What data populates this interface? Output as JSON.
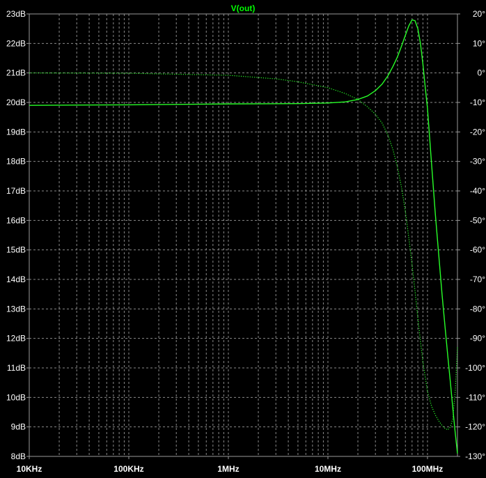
{
  "chart_data": {
    "type": "line",
    "title": "V(out)",
    "background": "#000000",
    "colors": {
      "trace": "#28ff28",
      "title": "#00ff00",
      "axis_text": "#ffffff",
      "grid": "#8a8a8a",
      "frame": "#9a9a9a"
    },
    "x_scale": "log",
    "x_range_hz": [
      10000,
      200000000
    ],
    "x_tick_values": [
      10000,
      100000,
      1000000,
      10000000,
      100000000
    ],
    "x_tick_labels": [
      "10KHz",
      "100KHz",
      "1MHz",
      "10MHz",
      "100MHz"
    ],
    "y_left_range": [
      8,
      23
    ],
    "y_left_ticks": [
      8,
      9,
      10,
      11,
      12,
      13,
      14,
      15,
      16,
      17,
      18,
      19,
      20,
      21,
      22,
      23
    ],
    "y_left_tick_labels": [
      "8dB",
      "9dB",
      "10dB",
      "11dB",
      "12dB",
      "13dB",
      "14dB",
      "15dB",
      "16dB",
      "17dB",
      "18dB",
      "19dB",
      "20dB",
      "21dB",
      "22dB",
      "23dB"
    ],
    "y_right_range": [
      -130,
      20
    ],
    "y_right_ticks": [
      -130,
      -120,
      -110,
      -100,
      -90,
      -80,
      -70,
      -60,
      -50,
      -40,
      -30,
      -20,
      -10,
      0,
      10,
      20
    ],
    "y_right_tick_labels": [
      "-130°",
      "-120°",
      "-110°",
      "-100°",
      "-90°",
      "-80°",
      "-70°",
      "-60°",
      "-50°",
      "-40°",
      "-30°",
      "-20°",
      "-10°",
      "0°",
      "10°",
      "20°"
    ],
    "grid": true,
    "series": [
      {
        "name": "magnitude",
        "axis": "left",
        "style": "solid",
        "x": [
          10000,
          100000,
          1000000,
          5000000,
          10000000,
          15000000,
          20000000,
          25000000,
          30000000,
          35000000,
          40000000,
          45000000,
          50000000,
          55000000,
          60000000,
          65000000,
          70000000,
          75000000,
          80000000,
          85000000,
          90000000,
          95000000,
          100000000,
          110000000,
          120000000,
          130000000,
          140000000,
          150000000,
          160000000,
          170000000,
          180000000,
          190000000,
          200000000
        ],
        "y": [
          19.9,
          19.92,
          19.95,
          19.96,
          19.98,
          20.02,
          20.1,
          20.22,
          20.4,
          20.62,
          20.9,
          21.22,
          21.55,
          21.92,
          22.28,
          22.6,
          22.8,
          22.77,
          22.5,
          22.0,
          21.3,
          20.5,
          19.8,
          17.9,
          16.2,
          14.8,
          13.5,
          12.4,
          11.4,
          10.5,
          9.6,
          8.8,
          8.1
        ]
      },
      {
        "name": "phase",
        "axis": "right",
        "style": "dotted",
        "x": [
          10000,
          100000,
          1000000,
          3000000,
          5000000,
          10000000,
          15000000,
          20000000,
          25000000,
          30000000,
          35000000,
          40000000,
          45000000,
          50000000,
          55000000,
          60000000,
          65000000,
          70000000,
          75000000,
          80000000,
          85000000,
          90000000,
          100000000,
          110000000,
          120000000,
          130000000,
          140000000,
          150000000,
          160000000,
          170000000,
          180000000,
          190000000,
          200000000
        ],
        "y": [
          0,
          -0.1,
          -0.8,
          -2.0,
          -3.0,
          -5.0,
          -7.0,
          -9.0,
          -11.5,
          -14.0,
          -17.0,
          -21.0,
          -26.0,
          -32.0,
          -39.0,
          -47.0,
          -56.0,
          -65.0,
          -74.0,
          -83.0,
          -91.0,
          -98.0,
          -108.0,
          -113.0,
          -116.0,
          -118.0,
          -119.5,
          -120.5,
          -121.0,
          -120.0,
          -117.0,
          -108.0,
          -93.0
        ]
      }
    ]
  }
}
